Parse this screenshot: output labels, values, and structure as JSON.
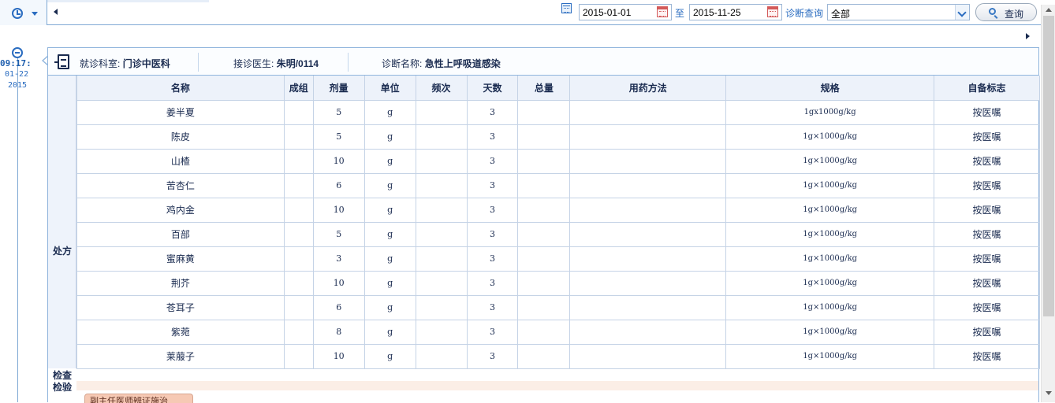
{
  "toolbar": {
    "date_from": "2015-01-01",
    "to_label": "至",
    "date_to": "2015-11-25",
    "diag_query_label": "诊断查询",
    "diag_query_value": "全部",
    "query_button": "查询"
  },
  "timeline": {
    "time": "09:17:",
    "date": "01-22",
    "year": "2015"
  },
  "record": {
    "dept_label": "就诊科室:",
    "dept_value": "门诊中医科",
    "doctor_label": "接诊医生:",
    "doctor_value": "朱明/0114",
    "diagnosis_label": "诊断名称:",
    "diagnosis_value": "急性上呼吸道感染"
  },
  "sections": {
    "prescription": "处方",
    "check": "检查",
    "lab": "检验",
    "note_tag": "副主任医师辨证施治"
  },
  "table": {
    "headers": [
      "名称",
      "成组",
      "剂量",
      "单位",
      "频次",
      "天数",
      "总量",
      "用药方法",
      "规格",
      "自备标志"
    ],
    "rows": [
      [
        "姜半夏",
        "",
        "5",
        "g",
        "",
        "3",
        "",
        "",
        "1gx1000g/kg",
        "按医嘱"
      ],
      [
        "陈皮",
        "",
        "5",
        "g",
        "",
        "3",
        "",
        "",
        "1g×1000g/kg",
        "按医嘱"
      ],
      [
        "山楂",
        "",
        "10",
        "g",
        "",
        "3",
        "",
        "",
        "1g×1000g/kg",
        "按医嘱"
      ],
      [
        "苦杏仁",
        "",
        "6",
        "g",
        "",
        "3",
        "",
        "",
        "1g×1000g/kg",
        "按医嘱"
      ],
      [
        "鸡内金",
        "",
        "10",
        "g",
        "",
        "3",
        "",
        "",
        "1g×1000g/kg",
        "按医嘱"
      ],
      [
        "百部",
        "",
        "5",
        "g",
        "",
        "3",
        "",
        "",
        "1g×1000g/kg",
        "按医嘱"
      ],
      [
        "蜜麻黄",
        "",
        "3",
        "g",
        "",
        "3",
        "",
        "",
        "1g×1000g/kg",
        "按医嘱"
      ],
      [
        "荆芥",
        "",
        "10",
        "g",
        "",
        "3",
        "",
        "",
        "1g×1000g/kg",
        "按医嘱"
      ],
      [
        "苍耳子",
        "",
        "6",
        "g",
        "",
        "3",
        "",
        "",
        "1g×1000g/kg",
        "按医嘱"
      ],
      [
        "紫菀",
        "",
        "8",
        "g",
        "",
        "3",
        "",
        "",
        "1g×1000g/kg",
        "按医嘱"
      ],
      [
        "莱菔子",
        "",
        "10",
        "g",
        "",
        "3",
        "",
        "",
        "1g×1000g/kg",
        "按医嘱"
      ]
    ]
  }
}
